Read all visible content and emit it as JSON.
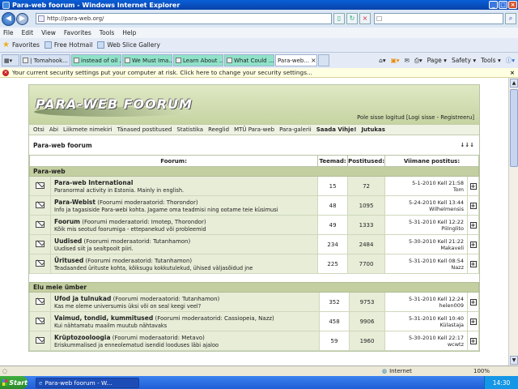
{
  "window": {
    "title": "Para-web foorum - Windows Internet Explorer"
  },
  "address": {
    "url": "http://para-web.org/"
  },
  "menu": [
    "File",
    "Edit",
    "View",
    "Favorites",
    "Tools",
    "Help"
  ],
  "favorites_bar": {
    "favorites_label": "Favorites",
    "items": [
      "Free Hotmail",
      "Web Slice Gallery"
    ]
  },
  "tabs": [
    {
      "label": "| Tomahook...",
      "style": "normal"
    },
    {
      "label": "instead of oil ...",
      "style": "green"
    },
    {
      "label": "We Must Ima...",
      "style": "green"
    },
    {
      "label": "Learn About ...",
      "style": "green"
    },
    {
      "label": "What Could ...",
      "style": "green"
    },
    {
      "label": "Para-web...",
      "style": "active"
    }
  ],
  "commandbar": {
    "page": "Page",
    "safety": "Safety",
    "tools": "Tools"
  },
  "infobar": {
    "text": "Your current security settings put your computer at risk. Click here to change your security settings..."
  },
  "site": {
    "logo": "PARA-WEB FOORUM",
    "login": "Pole sisse logitud [Logi sisse - Registreeru]",
    "nav": [
      "Otsi",
      "Abi",
      "Liikmete nimekiri",
      "Tänased postitused",
      "Statistika",
      "Reeglid",
      "MTÜ Para-web",
      "Para-galerii",
      "Saada Vihje!",
      "Jutukas"
    ],
    "breadcrumb": "Para-web foorum",
    "sort_arrows": "↓↓↓"
  },
  "table": {
    "headers": {
      "forum": "Foorum:",
      "topics": "Teemad:",
      "posts": "Postitused:",
      "last": "Viimane postitus:"
    },
    "categories": [
      {
        "name": "Para-web",
        "forums": [
          {
            "name": "Para-web International",
            "mods": "",
            "desc": "Paranormal activity in Estonia. Mainly in english.",
            "topics": "15",
            "posts": "72",
            "last_date": "5-1-2010 Kell 21:58",
            "last_user": "Tom"
          },
          {
            "name": "Para-Webist",
            "mods": "(Foorumi moderaatorid: Thorondor)",
            "desc": "Info ja tagasiside Para-webi kohta. Jagame oma teadmisi ning ootame teie küsimusi",
            "topics": "48",
            "posts": "1095",
            "last_date": "5-24-2010 Kell 13:44",
            "last_user": "Wilhelmensis"
          },
          {
            "name": "Foorum",
            "mods": "(Foorumi moderaatorid: Imotep, Thorondor)",
            "desc": "Kõik mis seotud foorumiga - ettepanekud või probleemid",
            "topics": "49",
            "posts": "1333",
            "last_date": "5-31-2010 Kell 12:22",
            "last_user": "PiiInglito"
          },
          {
            "name": "Uudised",
            "mods": "(Foorumi moderaatorid: Tutanhamon)",
            "desc": "Uudised siit ja sealtpoolt piiri.",
            "topics": "234",
            "posts": "2484",
            "last_date": "5-30-2010 Kell 21:22",
            "last_user": "Makaveli"
          },
          {
            "name": "Üritused",
            "mods": "(Foorumi moderaatorid: Tutanhamon)",
            "desc": "Teadaanded ürituste kohta, kõiksugu kokkutulekud, ühised väljasõidud jne",
            "topics": "225",
            "posts": "7700",
            "last_date": "5-31-2010 Kell 08:54",
            "last_user": "Nazz"
          }
        ]
      },
      {
        "name": "Elu meie ümber",
        "forums": [
          {
            "name": "Ufod ja tulnukad",
            "mods": "(Foorumi moderaatorid: Tutanhamon)",
            "desc": "Kas me oleme universumis üksi või on seal keegi veel?",
            "topics": "352",
            "posts": "9753",
            "last_date": "5-31-2010 Kell 12:24",
            "last_user": "helen009"
          },
          {
            "name": "Vaimud, tondid, kummitused",
            "mods": "(Foorumi moderaatorid: Cassiopeia, Nazz)",
            "desc": "Kui nähtamatu maailm muutub nähtavaks",
            "topics": "458",
            "posts": "9906",
            "last_date": "5-31-2010 Kell 10:40",
            "last_user": "Külastaja"
          },
          {
            "name": "Krüptozooloogia",
            "mods": "(Foorumi moderaatorid: Metavo)",
            "desc": "Eriskummalised ja enneolematud isendid looduses läbi ajaloo",
            "topics": "59",
            "posts": "1960",
            "last_date": "5-30-2010 Kell 22:17",
            "last_user": "wcwtz"
          }
        ]
      }
    ]
  },
  "statusbar": {
    "zone": "Internet",
    "zoom": "100%"
  },
  "taskbar": {
    "start": "Start",
    "item": "Para-web foorum - W...",
    "clock": "14:30"
  }
}
